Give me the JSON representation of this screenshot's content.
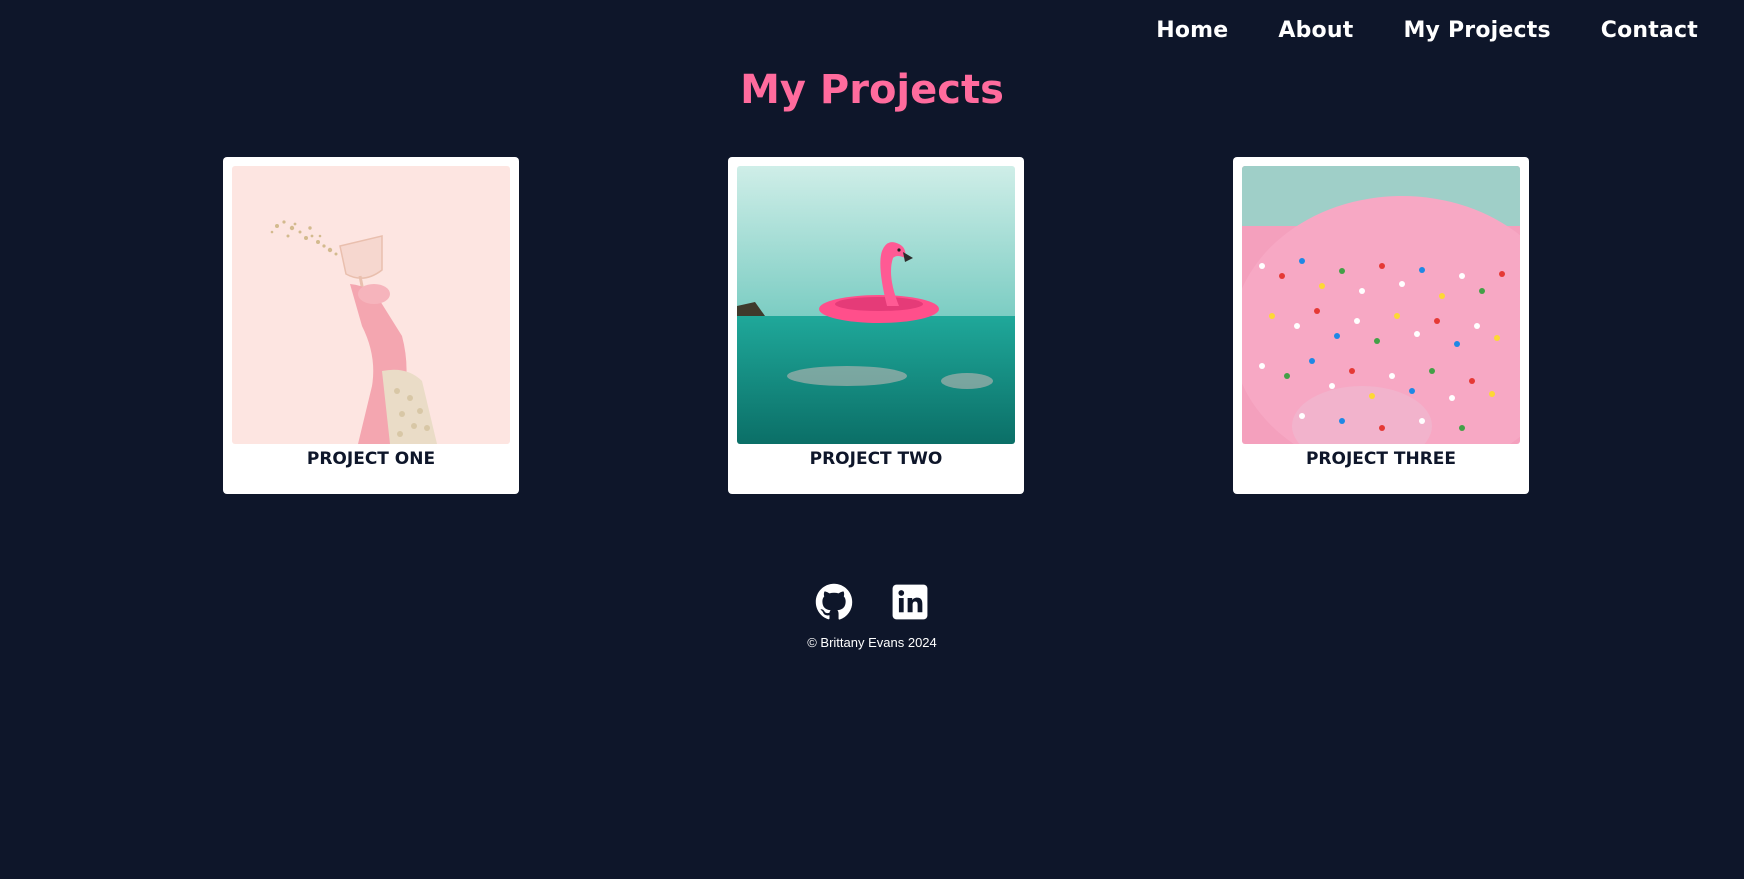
{
  "nav": {
    "items": [
      {
        "label": "Home"
      },
      {
        "label": "About"
      },
      {
        "label": "My Projects"
      },
      {
        "label": "Contact"
      }
    ]
  },
  "main": {
    "title": "My Projects",
    "projects": [
      {
        "title": "Project One",
        "image": "champagne-glass-on-pink"
      },
      {
        "title": "Project Two",
        "image": "flamingo-float-on-sea"
      },
      {
        "title": "Project Three",
        "image": "pink-sprinkle-donut"
      }
    ]
  },
  "footer": {
    "social": [
      {
        "icon": "github-icon"
      },
      {
        "icon": "linkedin-icon"
      }
    ],
    "copyright": "© Brittany Evans 2024"
  },
  "colors": {
    "background": "#0e162a",
    "accent": "#ff6b9d",
    "card": "#ffffff",
    "nav_text": "#ffffff"
  }
}
